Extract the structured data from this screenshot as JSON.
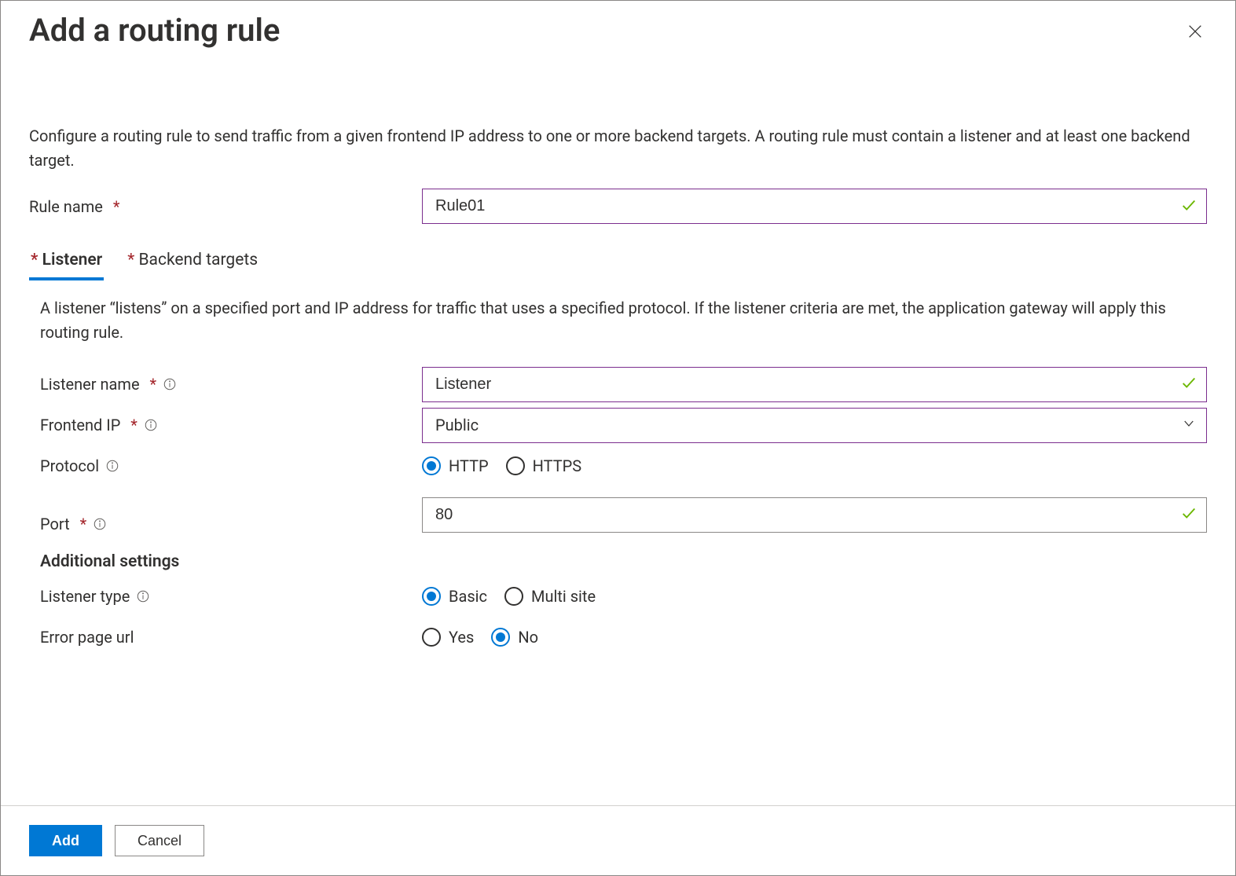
{
  "header": {
    "title": "Add a routing rule"
  },
  "description": "Configure a routing rule to send traffic from a given frontend IP address to one or more backend targets. A routing rule must contain a listener and at least one backend target.",
  "ruleName": {
    "label": "Rule name",
    "value": "Rule01"
  },
  "tabs": {
    "listener": "Listener",
    "backendTargets": "Backend targets"
  },
  "listener": {
    "description": "A listener “listens” on a specified port and IP address for traffic that uses a specified protocol. If the listener criteria are met, the application gateway will apply this routing rule.",
    "name": {
      "label": "Listener name",
      "value": "Listener"
    },
    "frontendIp": {
      "label": "Frontend IP",
      "value": "Public"
    },
    "protocol": {
      "label": "Protocol",
      "options": {
        "http": "HTTP",
        "https": "HTTPS"
      },
      "selected": "http"
    },
    "port": {
      "label": "Port",
      "value": "80"
    },
    "additionalHeading": "Additional settings",
    "listenerType": {
      "label": "Listener type",
      "options": {
        "basic": "Basic",
        "multi": "Multi site"
      },
      "selected": "basic"
    },
    "errorPageUrl": {
      "label": "Error page url",
      "options": {
        "yes": "Yes",
        "no": "No"
      },
      "selected": "no"
    }
  },
  "footer": {
    "add": "Add",
    "cancel": "Cancel"
  }
}
